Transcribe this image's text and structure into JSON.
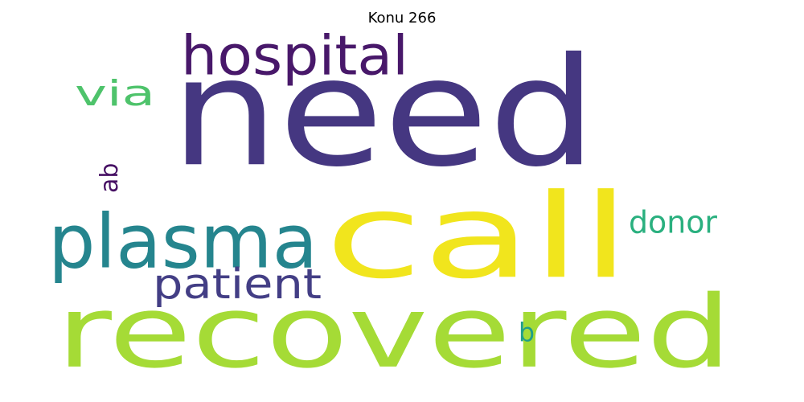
{
  "title": "Konu 266",
  "words": [
    {
      "key": "need",
      "text": "need",
      "color": "#453781"
    },
    {
      "key": "recovered",
      "text": "recovered",
      "color": "#a5db36"
    },
    {
      "key": "call",
      "text": "call",
      "color": "#f1e51d"
    },
    {
      "key": "plasma",
      "text": "plasma",
      "color": "#25858e"
    },
    {
      "key": "hospital",
      "text": "hospital",
      "color": "#48186a"
    },
    {
      "key": "patient",
      "text": "patient",
      "color": "#433e85"
    },
    {
      "key": "via",
      "text": "via",
      "color": "#4ec36b"
    },
    {
      "key": "donor",
      "text": "donor",
      "color": "#2ab07f"
    },
    {
      "key": "ab",
      "text": "ab",
      "color": "#471164"
    },
    {
      "key": "b",
      "text": "b",
      "color": "#1f9e89"
    }
  ]
}
